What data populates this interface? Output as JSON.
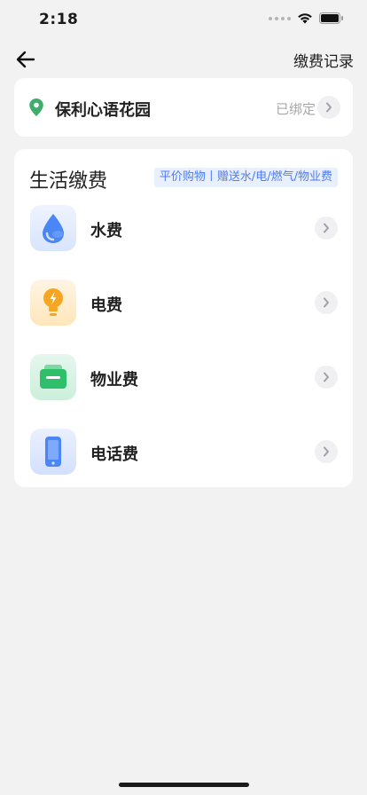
{
  "status_bar": {
    "time": "2:18"
  },
  "nav": {
    "records_label": "缴费记录"
  },
  "community": {
    "name": "保利心语花园",
    "status": "已绑定"
  },
  "bills": {
    "title": "生活缴费",
    "promo": "平价购物丨赠送水/电/燃气/物业费",
    "items": [
      {
        "label": "水费",
        "icon": "water-drop-icon",
        "color": "#4a86f5"
      },
      {
        "label": "电费",
        "icon": "lightbulb-icon",
        "color": "#f5a623"
      },
      {
        "label": "物业费",
        "icon": "wallet-icon",
        "color": "#2fbf6a"
      },
      {
        "label": "电话费",
        "icon": "phone-icon",
        "color": "#4a86f5"
      }
    ]
  },
  "colors": {
    "accent": "#4d7cf5",
    "location": "#3fae6a",
    "background": "#f2f2f2"
  }
}
